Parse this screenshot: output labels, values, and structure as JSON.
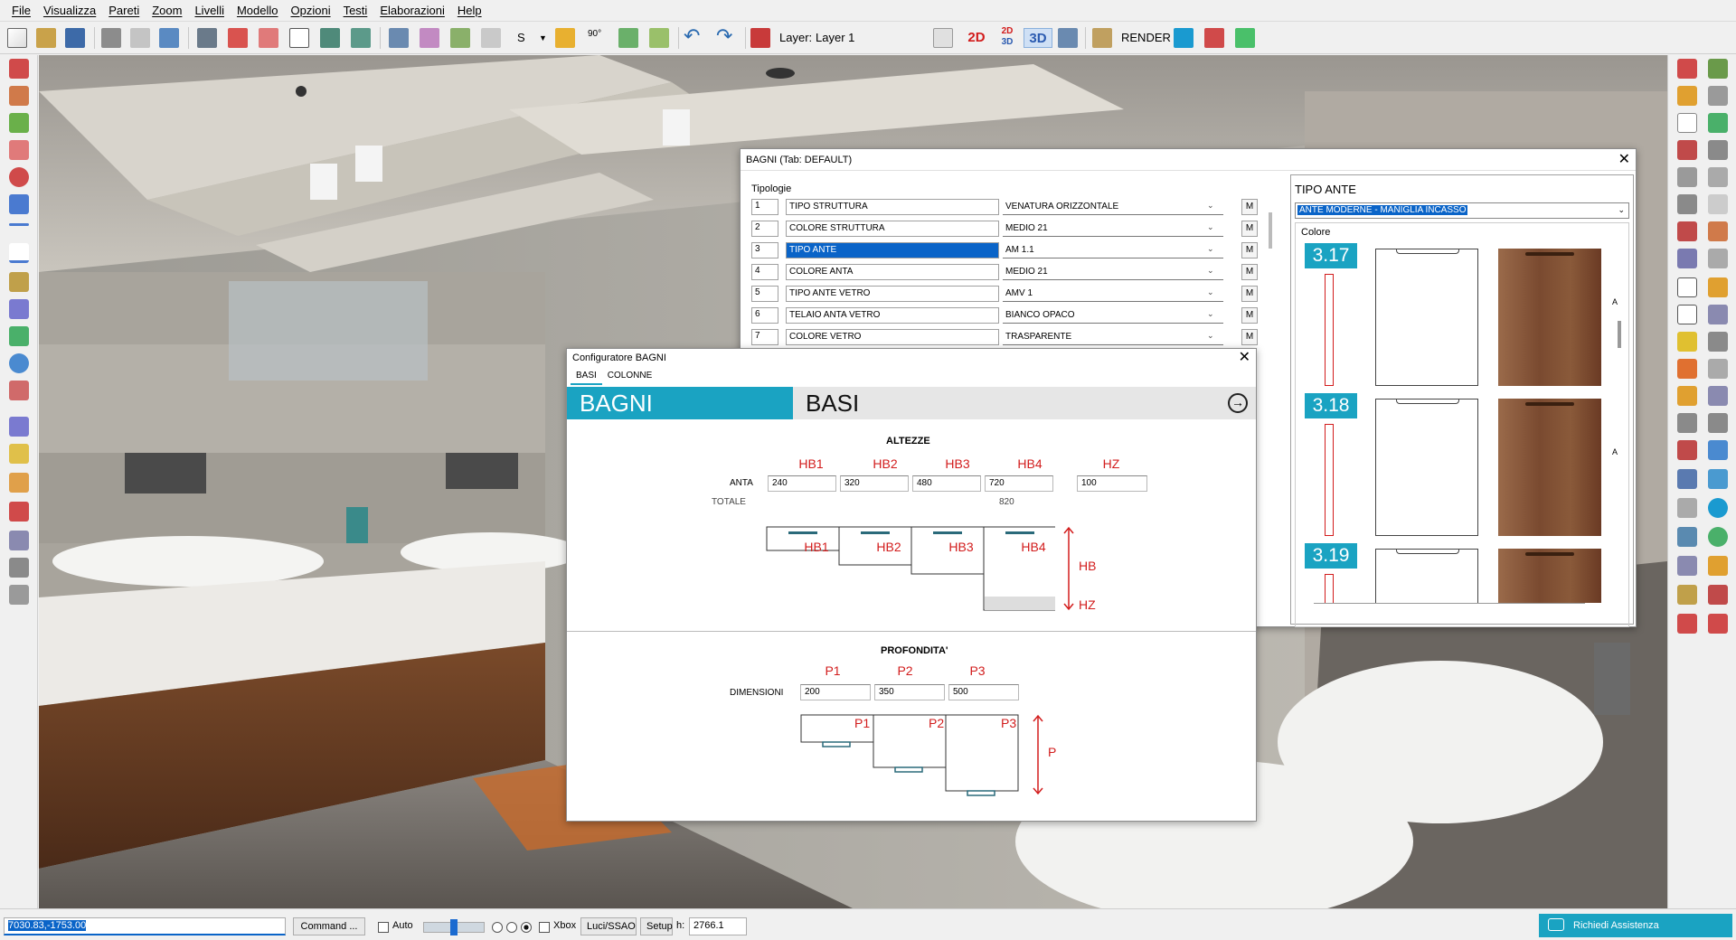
{
  "menu": [
    "File",
    "Visualizza",
    "Pareti",
    "Zoom",
    "Livelli",
    "Modello",
    "Opzioni",
    "Testi",
    "Elaborazioni",
    "Help"
  ],
  "toolbar": {
    "s_label": "S",
    "angle_label": "90°",
    "layer_label": "Layer:",
    "layer_value": "Layer 1",
    "view_2d": "2D",
    "view_2d3d_top": "2D",
    "view_2d3d_bottom": "3D",
    "view_3d": "3D",
    "render_label": "RENDER"
  },
  "bagni_window": {
    "title": "BAGNI (Tab: DEFAULT)",
    "section_label": "Tipologie",
    "rows": [
      {
        "num": "1",
        "name": "TIPO STRUTTURA",
        "value": "VENATURA ORIZZONTALE",
        "m": "M",
        "selected": false
      },
      {
        "num": "2",
        "name": "COLORE STRUTTURA",
        "value": "MEDIO 21",
        "m": "M",
        "selected": false
      },
      {
        "num": "3",
        "name": "TIPO ANTE",
        "value": "AM  1.1",
        "m": "M",
        "selected": true
      },
      {
        "num": "4",
        "name": "COLORE ANTA",
        "value": "MEDIO 21",
        "m": "M",
        "selected": false
      },
      {
        "num": "5",
        "name": "TIPO ANTE VETRO",
        "value": "AMV 1",
        "m": "M",
        "selected": false
      },
      {
        "num": "6",
        "name": "TELAIO ANTA VETRO",
        "value": "BIANCO OPACO",
        "m": "M",
        "selected": false
      },
      {
        "num": "7",
        "name": "COLORE VETRO",
        "value": "TRASPARENTE",
        "m": "M",
        "selected": false
      }
    ],
    "close": "✕"
  },
  "tipo_ante_panel": {
    "title": "TIPO ANTE",
    "dropdown_value": "ANTE MODERNE - MANIGLIA INCASSO",
    "colore_label": "Colore",
    "swatches": [
      {
        "code": "3.17",
        "side_letter": "A"
      },
      {
        "code": "3.18",
        "side_letter": "A"
      },
      {
        "code": "3.19",
        "side_letter": ""
      }
    ]
  },
  "configuratore": {
    "title": "Configuratore BAGNI",
    "close": "✕",
    "tabs": [
      "BASI",
      "COLONNE"
    ],
    "header_left": "BAGNI",
    "header_right": "BASI",
    "altezze": {
      "title": "ALTEZZE",
      "col_labels": [
        "HB1",
        "HB2",
        "HB3",
        "HB4",
        "HZ"
      ],
      "row_label": "ANTA",
      "values": [
        "240",
        "320",
        "480",
        "720",
        "100"
      ],
      "totale_label": "TOTALE",
      "totale_value": "820",
      "diagram_labels": [
        "HB1",
        "HB2",
        "HB3",
        "HB4"
      ],
      "hb_label": "HB",
      "hz_label": "HZ"
    },
    "profondita": {
      "title": "PROFONDITA'",
      "col_labels": [
        "P1",
        "P2",
        "P3"
      ],
      "row_label": "DIMENSIONI",
      "values": [
        "200",
        "350",
        "500"
      ],
      "diagram_labels": [
        "P1",
        "P2",
        "P3"
      ],
      "p_label": "P"
    }
  },
  "status": {
    "coords": "7030.83,-1753.00",
    "command_btn": "Command ...",
    "auto_label": "Auto",
    "xbox_label": "Xbox",
    "luci_btn": "Luci/SSAO",
    "setup_btn": "Setup",
    "h_label": "h:",
    "h_value": "2766.1",
    "assist_label": "Richiedi Assistenza"
  },
  "colors": {
    "accent_teal": "#1aa3c2",
    "selection_blue": "#0a64c8",
    "diagram_red": "#d21c1c"
  }
}
